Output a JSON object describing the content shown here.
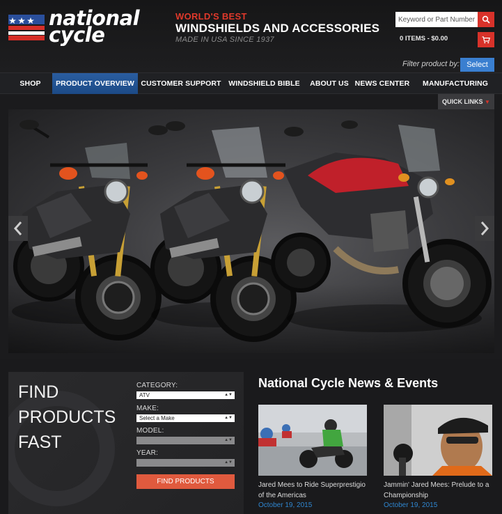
{
  "brand": {
    "logo_line1": "national",
    "logo_line2": "cycle",
    "tagline_top": "WORLD'S BEST",
    "tagline_main": "WINDSHIELDS AND ACCESSORIES",
    "tagline_sub": "MADE IN USA SINCE 1937",
    "colors": {
      "accent_red": "#d8322a",
      "nav_blue": "#2a5da0",
      "date_blue": "#2f86d0"
    }
  },
  "search": {
    "placeholder": "Keyword or Part Number",
    "icon": "search-icon"
  },
  "cart": {
    "summary": "0 ITEMS - $0.00",
    "icon": "cart-icon"
  },
  "filter": {
    "label": "Filter product by:",
    "button_label": "Select"
  },
  "nav": {
    "items": [
      {
        "label": "SHOP"
      },
      {
        "label": "PRODUCT OVERVIEW"
      },
      {
        "label": "CUSTOMER SUPPORT"
      },
      {
        "label": "WINDSHIELD BIBLE"
      },
      {
        "label": "ABOUT US"
      },
      {
        "label": "NEWS CENTER"
      },
      {
        "label": "MANUFACTURING"
      }
    ],
    "active_index": 1
  },
  "quick_links": {
    "label": "QUICK LINKS"
  },
  "slider": {
    "prev_icon": "chevron-left-icon",
    "next_icon": "chevron-right-icon"
  },
  "finder": {
    "title_line1": "FIND",
    "title_line2": "PRODUCTS",
    "title_line3": "FAST",
    "category_label": "CATEGORY:",
    "category_value": "ATV",
    "make_label": "MAKE:",
    "make_value": "Select a Make",
    "model_label": "MODEL:",
    "year_label": "YEAR:",
    "button_label": "FIND PRODUCTS"
  },
  "news": {
    "heading": "National Cycle News & Events",
    "articles": [
      {
        "caption": "Jared Mees to Ride Superprestigio of the Americas",
        "date": "October 19, 2015"
      },
      {
        "caption": "Jammin' Jared Mees: Prelude to a Championship",
        "date": "October 19, 2015"
      }
    ]
  }
}
